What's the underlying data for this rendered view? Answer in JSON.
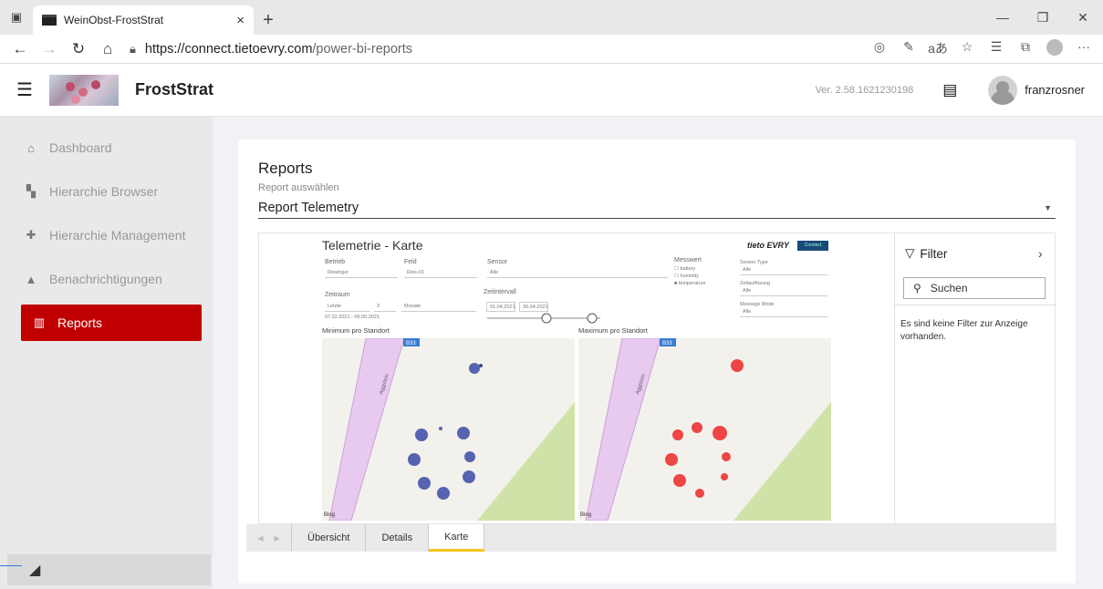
{
  "browser": {
    "tab_title": "WeinObst-FrostStrat",
    "url_proto": "https://connect.tietoevry.com",
    "url_path": "/power-bi-reports"
  },
  "header": {
    "brand": "FrostStrat",
    "version": "Ver. 2.58.1621230198",
    "username": "franzrosner"
  },
  "sidebar": {
    "items": [
      {
        "label": "Dashboard",
        "icon": "home-icon"
      },
      {
        "label": "Hierarchie Browser",
        "icon": "hierarchy-icon"
      },
      {
        "label": "Hierarchie Management",
        "icon": "puzzle-icon"
      },
      {
        "label": "Benachrichtigungen",
        "icon": "bell-icon"
      },
      {
        "label": "Reports",
        "icon": "chart-icon",
        "active": true
      }
    ]
  },
  "main": {
    "title": "Reports",
    "select_label": "Report auswählen",
    "selected_report": "Report Telemetry"
  },
  "report": {
    "title": "Telemetrie - Karte",
    "betrieb_label": "Betrieb",
    "betrieb_value": "Reisinger",
    "feld_label": "Feld",
    "feld_value": "Reis-01",
    "sensor_label": "Sensor",
    "sensor_value": "Alle",
    "messwert_label": "Messwert",
    "messwert_options": [
      "battery",
      "humidity",
      "temperature"
    ],
    "zeitraum_label": "Zeitraum",
    "zeitraum_mode": "Letzte",
    "zeitraum_num": "3",
    "zeitraum_unit": "Monate",
    "zeitraum_range": "07.02.2021 - 06.05.2021",
    "zeitintervall_label": "Zeitintervall",
    "zeit_from": "01.04.2021",
    "zeit_to": "30.04.2021",
    "right_filters": [
      {
        "label": "Sensor Type",
        "value": "Alle"
      },
      {
        "label": "Zeitauflösung",
        "value": "Alle"
      },
      {
        "label": "Message Mode",
        "value": "Alle"
      }
    ],
    "map_min_label": "Minimum pro Standort",
    "map_max_label": "Maximum pro Standort",
    "road_label": "Aggstein",
    "road_badge": "B33",
    "bing": "Bing",
    "logo_text": "tieto EVRY",
    "logo_connect": "Connect"
  },
  "filter": {
    "title": "Filter",
    "search_placeholder": "Suchen",
    "empty_text": "Es sind keine Filter zur Anzeige vorhanden."
  },
  "page_tabs": [
    "Übersicht",
    "Details",
    "Karte"
  ],
  "colors": {
    "accent": "#c00000",
    "min_dots": "#5563b0",
    "max_dots": "#ee4545",
    "tab_active": "#f2c811"
  }
}
